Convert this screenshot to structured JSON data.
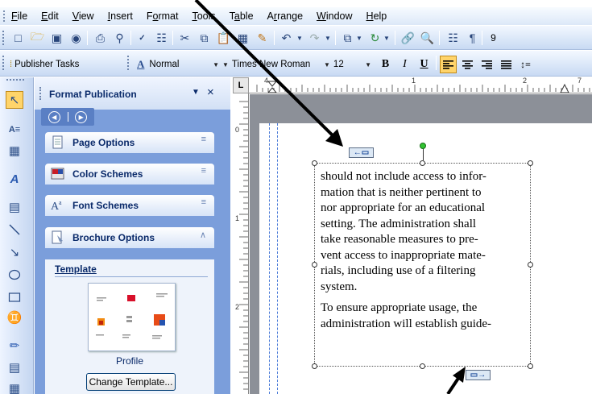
{
  "menubar": {
    "items": [
      {
        "label": "File",
        "accel": "F"
      },
      {
        "label": "Edit",
        "accel": "E"
      },
      {
        "label": "View",
        "accel": "V"
      },
      {
        "label": "Insert",
        "accel": "I"
      },
      {
        "label": "Format",
        "accel": "o"
      },
      {
        "label": "Tools",
        "accel": "T"
      },
      {
        "label": "Table",
        "accel": "a"
      },
      {
        "label": "Arrange",
        "accel": "r"
      },
      {
        "label": "Window",
        "accel": "W"
      },
      {
        "label": "Help",
        "accel": "H"
      }
    ]
  },
  "formatting_toolbar": {
    "publisher_tasks_label": "Publisher Tasks",
    "style_value": "Normal",
    "font_value": "Times New Roman",
    "size_value": "12",
    "bold_label": "B",
    "italic_label": "I",
    "underline_label": "U",
    "overflow_digit": "9"
  },
  "task_pane": {
    "title": "Format Publication",
    "sections": [
      {
        "label": "Page Options"
      },
      {
        "label": "Color Schemes"
      },
      {
        "label": "Font Schemes"
      },
      {
        "label": "Brochure Options"
      }
    ],
    "template_heading": "Template",
    "template_name": "Profile",
    "change_template_button": "Change Template..."
  },
  "rulers": {
    "corner": "L",
    "h_labels": [
      "4",
      "1",
      "2",
      "7"
    ],
    "v_labels": [
      "0",
      "1",
      "2"
    ]
  },
  "text_frame": {
    "paragraphs": [
      "should not include access to information that is neither pertinent to nor appropriate for an educational setting.  The administration shall take reasonable measures to prevent access to inappropriate materials, including use of a filtering system.",
      "To ensure appropriate usage, the administration will establish guide-"
    ],
    "lines": [
      "should not include access to infor-",
      "mation that is neither pertinent to",
      "nor appropriate for an educational",
      "setting.  The administration shall",
      "take reasonable measures to pre-",
      "vent access to inappropriate mate-",
      "rials, including use of a filtering",
      "system."
    ],
    "lines2": [
      "To ensure appropriate usage, the",
      "administration will establish guide-"
    ]
  },
  "colors": {
    "toolbar_bg": "#dce8f8",
    "task_pane_bg": "#7b9edb",
    "active_button": "#ffd46a",
    "workspace_gray": "#8c9098",
    "guide_blue": "#4a7bd8",
    "rotation_handle": "#31c331"
  },
  "icons": {
    "objects": [
      "select-arrow-icon",
      "text-box-icon",
      "table-icon",
      "wordart-icon",
      "picture-icon",
      "line-icon",
      "arrow-line-icon",
      "oval-icon",
      "rectangle-icon",
      "autoshapes-icon",
      "hot-spot-icon",
      "design-gallery-icon",
      "add-object-icon"
    ]
  }
}
